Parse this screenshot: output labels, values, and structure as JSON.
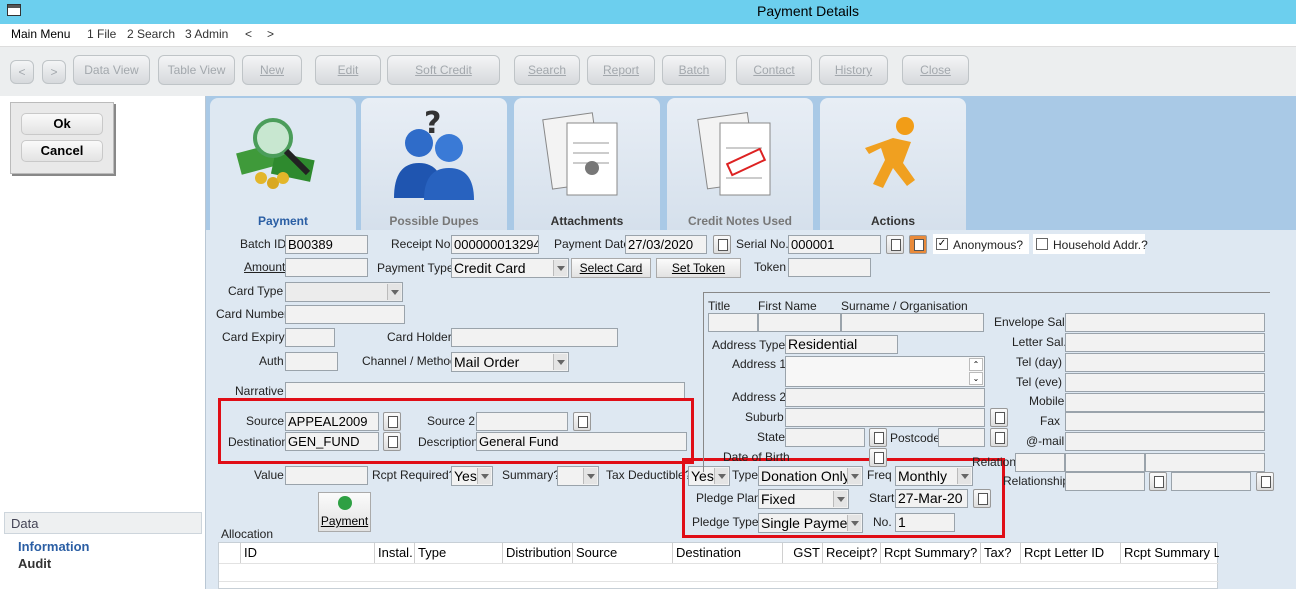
{
  "window": {
    "title": "Payment Details"
  },
  "menu": [
    "Main Menu",
    "1 File",
    "2 Search",
    "3 Admin",
    "<",
    ">"
  ],
  "toolbar": {
    "back": "<",
    "forward": ">",
    "buttons": [
      "Data View",
      "Table View",
      "New",
      "Edit",
      "Soft Credit",
      "Search",
      "Report",
      "Batch",
      "Contact",
      "History",
      "Close"
    ]
  },
  "dialog": {
    "ok": "Ok",
    "cancel": "Cancel"
  },
  "sidebar": {
    "header": "Data",
    "items": [
      "Information",
      "Audit"
    ]
  },
  "tabs": [
    "Payment",
    "Possible Dupes",
    "Attachments",
    "Credit Notes Used",
    "Actions"
  ],
  "form": {
    "batch_id_label": "Batch ID",
    "batch_id": "B00389",
    "receipt_no_label": "Receipt No.",
    "receipt_no": "000000013294",
    "payment_date_label": "Payment Date",
    "payment_date": "27/03/2020",
    "serial_no_label": "Serial No.",
    "serial_no": "000001",
    "anonymous_label": "Anonymous?",
    "anonymous": true,
    "household_label": "Household Addr.?",
    "household": false,
    "amount_label": "Amount",
    "amount": "",
    "payment_type_label": "Payment Type",
    "payment_type": "Credit Card",
    "select_card": "Select Card",
    "set_token": "Set Token",
    "token_label": "Token",
    "token": "",
    "card_type_label": "Card Type",
    "card_type": "",
    "card_number_label": "Card Number",
    "card_expiry_label": "Card Expiry",
    "card_holder_label": "Card Holder",
    "auth_label": "Auth",
    "channel_label": "Channel / Method",
    "channel": "Mail Order",
    "narrative_label": "Narrative",
    "source_label": "Source",
    "source": "APPEAL2009",
    "source2_label": "Source 2",
    "source2": "",
    "destination_label": "Destination",
    "destination": "GEN_FUND",
    "description_label": "Description",
    "description": "General Fund",
    "value_label": "Value",
    "rcpt_required_label": "Rcpt Required?",
    "rcpt_required": "Yes",
    "summary_label": "Summary?",
    "summary": "",
    "tax_deductible_label": "Tax Deductible?",
    "tax_deductible": "Yes",
    "type_label": "Type",
    "type": "Donation Only",
    "freq_label": "Freq",
    "freq": "Monthly",
    "pledge_plan_label": "Pledge Plan",
    "pledge_plan": "Fixed",
    "start_label": "Start",
    "start": "27-Mar-20",
    "pledge_type_label": "Pledge Type",
    "pledge_type": "Single Payme",
    "no_label": "No.",
    "no": "1",
    "payment_button": "Payment"
  },
  "contact": {
    "title_label": "Title",
    "first_name_label": "First Name",
    "surname_label": "Surname / Organisation",
    "envelope_sal_label": "Envelope Sal.",
    "letter_sal_label": "Letter Sal.",
    "address_type_label": "Address Type",
    "address_type": "Residential",
    "address1_label": "Address 1",
    "address2_label": "Address 2",
    "tel_day_label": "Tel (day)",
    "tel_eve_label": "Tel (eve)",
    "mobile_label": "Mobile",
    "suburb_label": "Suburb",
    "fax_label": "Fax",
    "state_label": "State",
    "postcode_label": "Postcode",
    "email_label": "@-mail",
    "dob_label": "Date of Birth",
    "relation_label": "Relation",
    "relationship_label": "Relationship"
  },
  "allocation": {
    "label": "Allocation",
    "columns": [
      "ID",
      "Instal.",
      "Type",
      "Distribution",
      "Source",
      "Destination",
      "GST",
      "Receipt?",
      "Rcpt Summary?",
      "Tax?",
      "Rcpt Letter ID",
      "Rcpt Summary L"
    ]
  },
  "colors": {
    "accent": "#2a5ea4",
    "highlight": "#e00d16",
    "titlebar": "#6ccfee"
  }
}
